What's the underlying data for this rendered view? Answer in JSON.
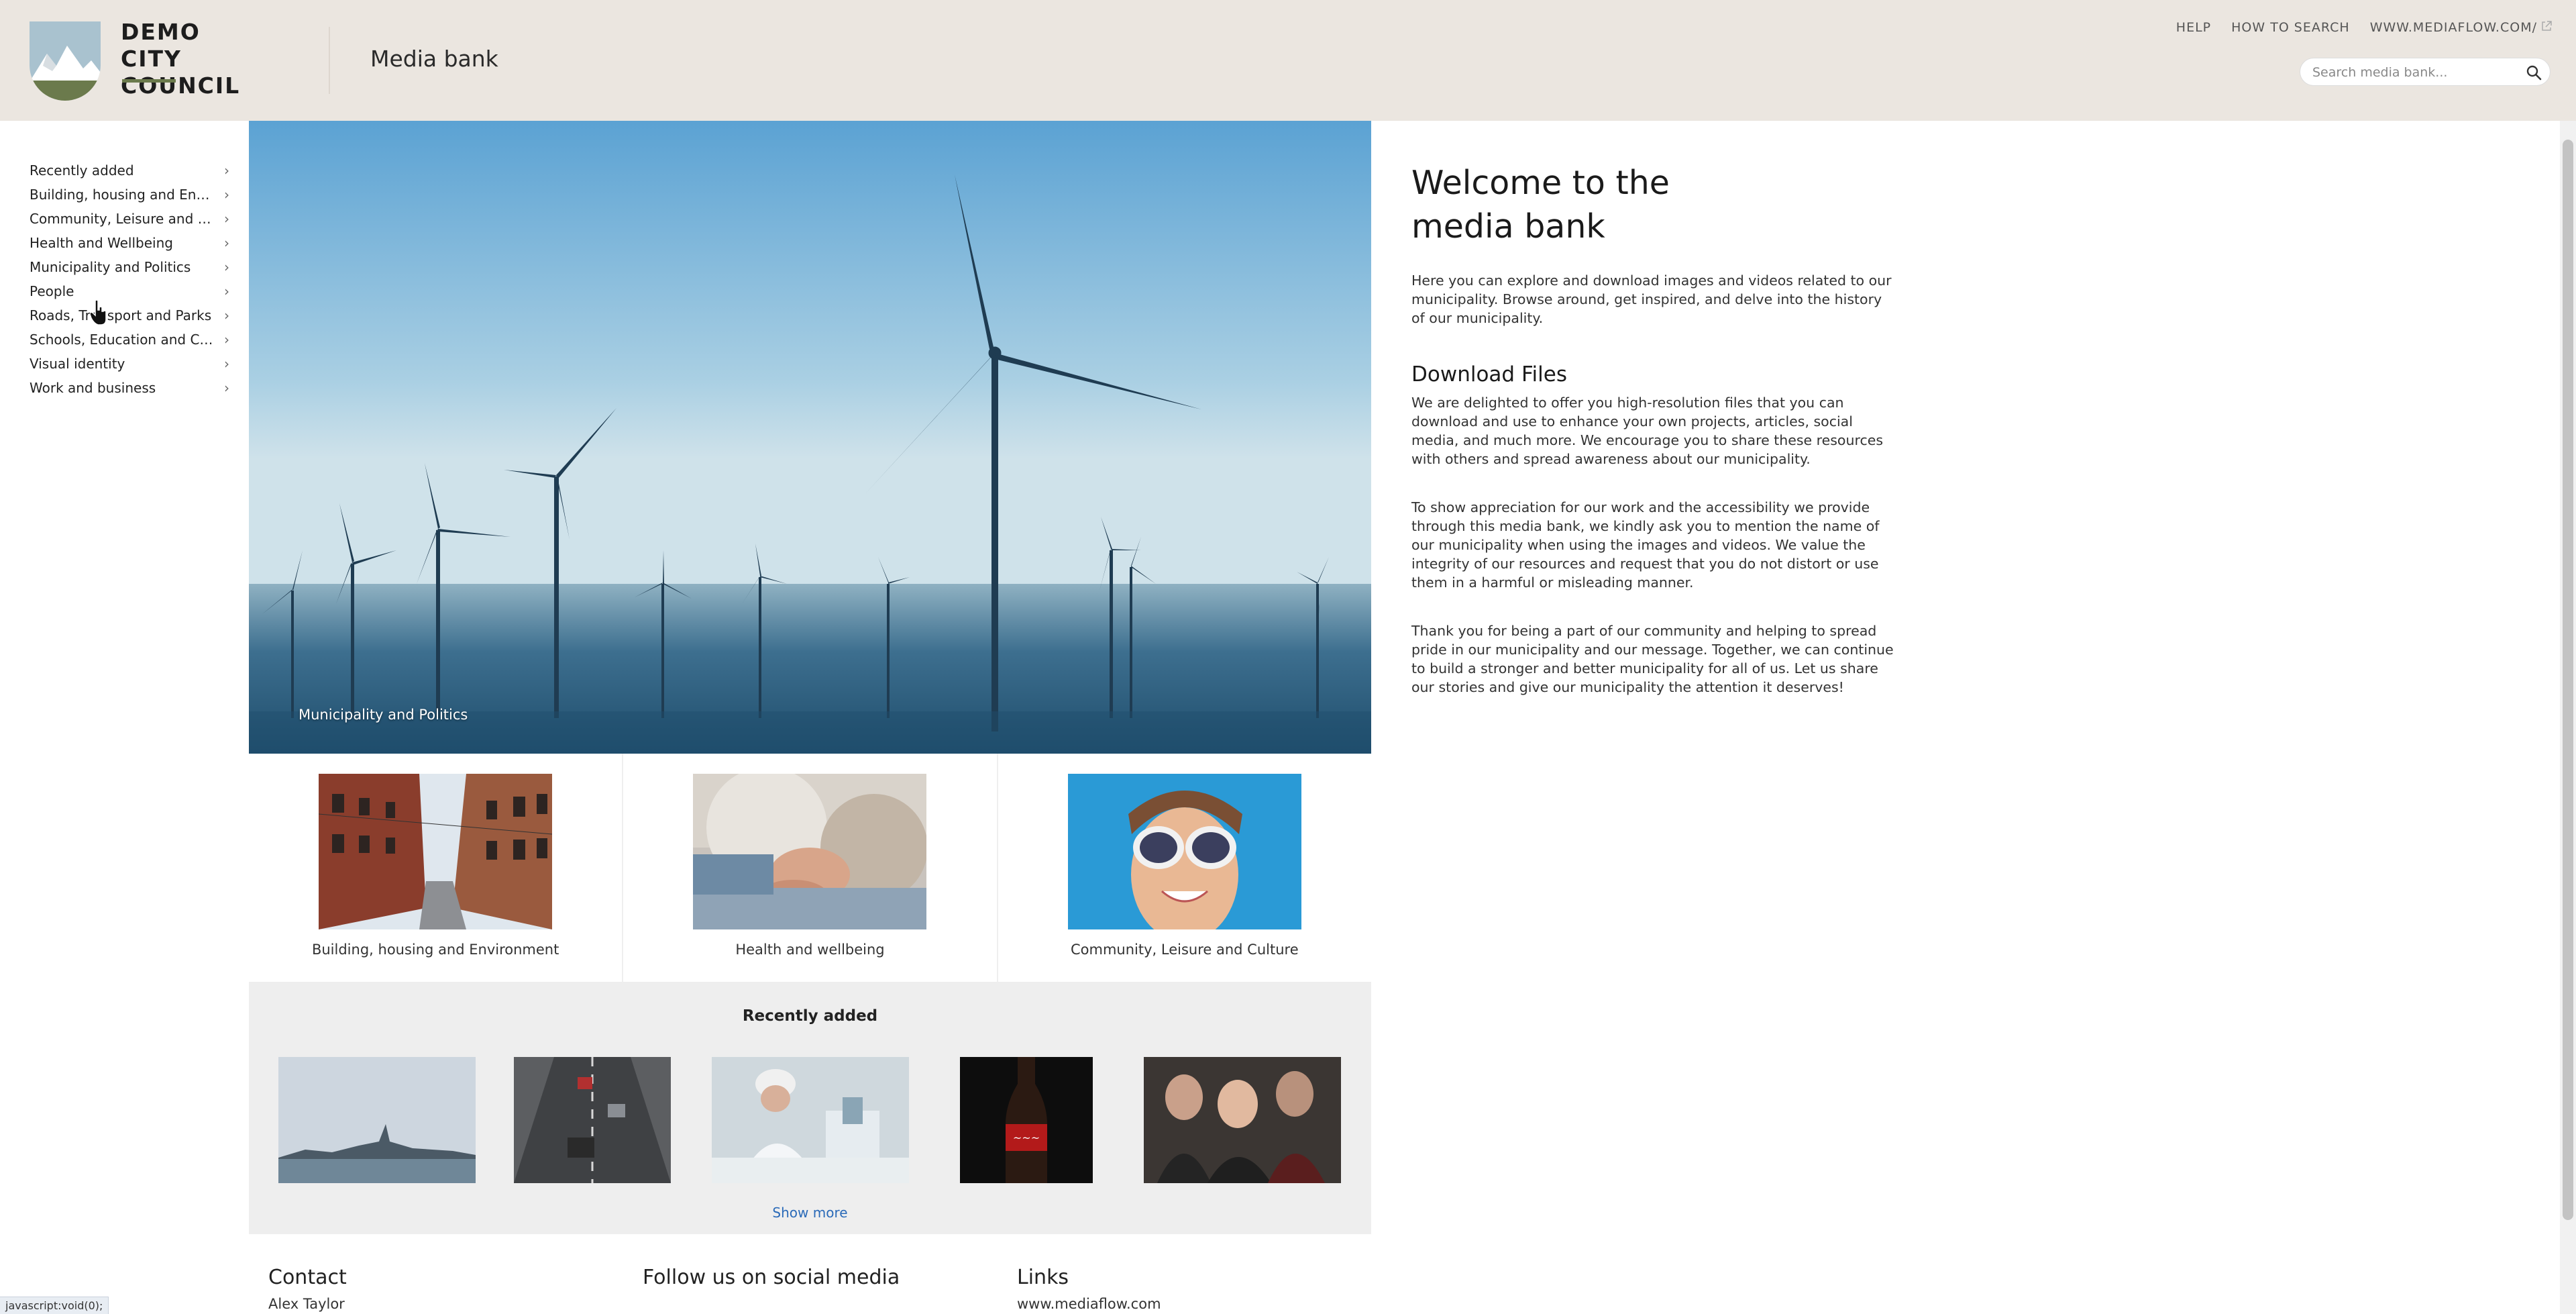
{
  "header": {
    "org_line1": "DEMO",
    "org_line2": "CITY COUNCIL",
    "app_title": "Media bank",
    "links": [
      "HELP",
      "HOW TO SEARCH",
      "WWW.MEDIAFLOW.COM/"
    ],
    "search_placeholder": "Search media bank..."
  },
  "sidebar": {
    "items": [
      {
        "label": "Recently added"
      },
      {
        "label": "Building, housing and Enviro..."
      },
      {
        "label": "Community, Leisure and Cult..."
      },
      {
        "label": "Health and Wellbeing"
      },
      {
        "label": "Municipality and Politics"
      },
      {
        "label": "People"
      },
      {
        "label": "Roads, Transport and Parks"
      },
      {
        "label": "Schools, Education and Child..."
      },
      {
        "label": "Visual identity"
      },
      {
        "label": "Work and business"
      }
    ]
  },
  "hero": {
    "caption": "Municipality and Politics"
  },
  "cards": [
    {
      "caption": "Building, housing and Environment"
    },
    {
      "caption": "Health and wellbeing"
    },
    {
      "caption": "Community, Leisure and Culture"
    }
  ],
  "recent": {
    "title": "Recently added",
    "show_more": "Show more"
  },
  "footer": {
    "contact_title": "Contact",
    "contact_name": "Alex Taylor",
    "social_title": "Follow us on social media",
    "links_title": "Links",
    "links_item": "www.mediaflow.com"
  },
  "welcome": {
    "title": "Welcome to the media bank",
    "intro": "Here you can explore and download images and videos related to our municipality. Browse around, get inspired, and delve into the history of our municipality.",
    "download_title": "Download Files",
    "download_p1": "We are delighted to offer you high-resolution files that you can download and use to enhance your own projects, articles, social media, and much more. We encourage you to share these resources with others and spread awareness about our municipality.",
    "download_p2": "To show appreciation for our work and the accessibility we provide through this media bank, we kindly ask you to mention the name of our municipality when using the images and videos. We value the integrity of our resources and request that you do not distort or use them in a harmful or misleading manner.",
    "download_p3": "Thank you for being a part of our community and helping to spread pride in our municipality and our message. Together, we can continue to build a stronger and better municipality for all of us. Let us share our stories and give our municipality the attention it deserves!"
  },
  "status_bar": "javascript:void(0);",
  "colors": {
    "header_bg": "#ebe6e0",
    "accent": "#6b7a4c",
    "link": "#2a6ab8"
  }
}
